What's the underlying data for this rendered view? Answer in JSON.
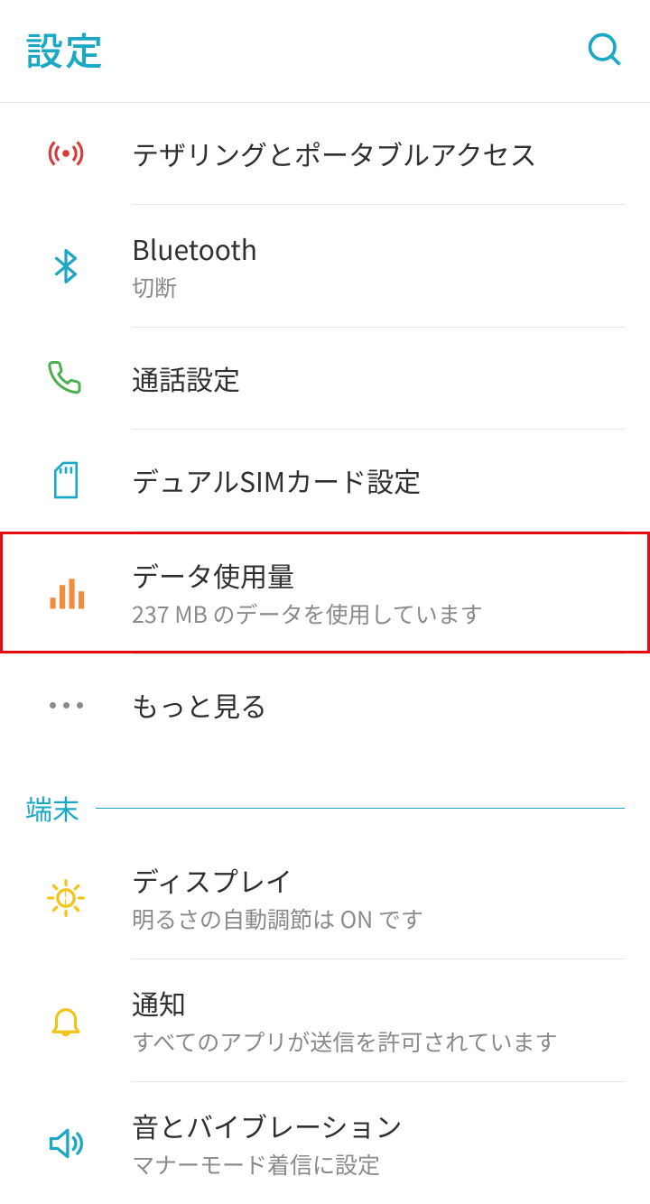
{
  "header": {
    "title": "設定"
  },
  "section": {
    "device": "端末"
  },
  "items": [
    {
      "title": "テザリングとポータブルアクセス",
      "sub": ""
    },
    {
      "title": "Bluetooth",
      "sub": "切断"
    },
    {
      "title": "通話設定",
      "sub": ""
    },
    {
      "title": "デュアルSIMカード設定",
      "sub": ""
    },
    {
      "title": "データ使用量",
      "sub": "237 MB のデータを使用しています"
    },
    {
      "title": "もっと見る",
      "sub": ""
    },
    {
      "title": "ディスプレイ",
      "sub": "明るさの自動調節は ON です"
    },
    {
      "title": "通知",
      "sub": "すべてのアプリが送信を許可されています"
    },
    {
      "title": "音とバイブレーション",
      "sub": "マナーモード着信に設定"
    }
  ],
  "colors": {
    "accent": "#1ba8c4",
    "highlight": "#e30b0b",
    "tethering": "#d93a3a",
    "bluetooth": "#1ba8c4",
    "call": "#4caf50",
    "sim": "#1ba8c4",
    "data": "#f28b3c",
    "more": "#8a8a8a",
    "display": "#f0c419",
    "notification": "#f0c419",
    "sound": "#1ba8c4"
  }
}
